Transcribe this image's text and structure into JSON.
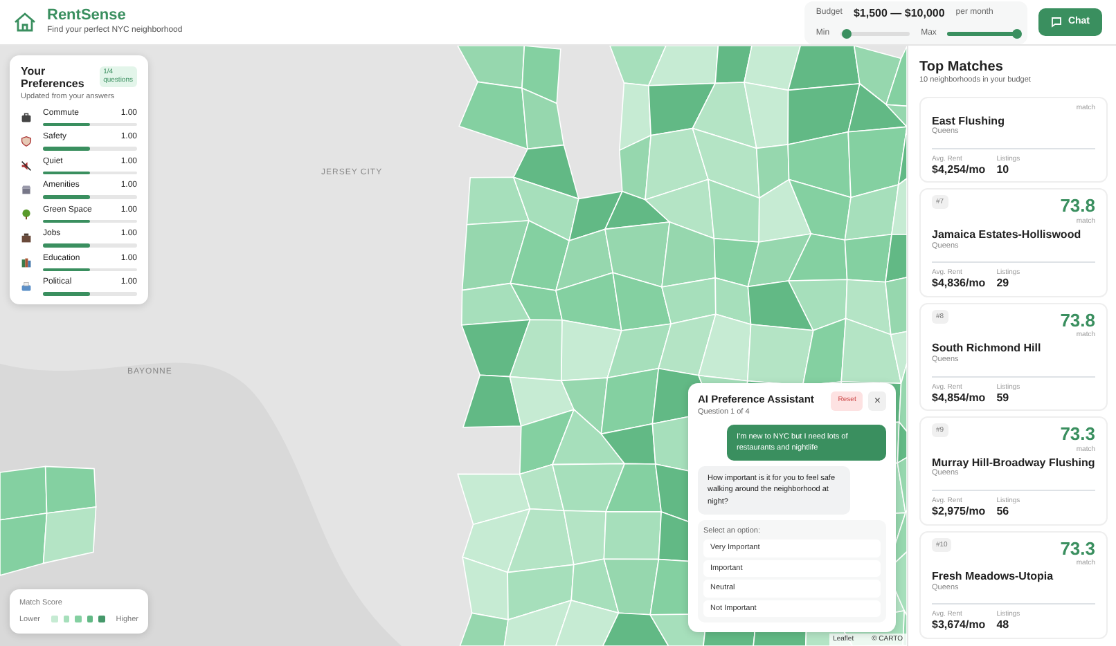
{
  "header": {
    "app_name": "RentSense",
    "tagline": "Find your perfect NYC neighborhood"
  },
  "budget": {
    "label": "Budget",
    "range": "$1,500 — $10,000",
    "unit": "per month",
    "sliders": [
      {
        "label": "Min",
        "level": 0.08
      },
      {
        "label": "Max",
        "level": 1
      }
    ]
  },
  "chat_button": "Chat",
  "map": {
    "labels": [
      "JERSEY CITY",
      "BAYONNE"
    ],
    "attribution": [
      "Leaflet",
      "© CARTO"
    ]
  },
  "preferences": {
    "title": "Your Preferences",
    "badge": "1/4 questions",
    "subtitle": "Updated from your answers",
    "items": [
      {
        "name": "Commute",
        "value": "1.00",
        "level": 0.5
      },
      {
        "name": "Safety",
        "value": "1.00",
        "level": 0.5
      },
      {
        "name": "Quiet",
        "value": "1.00",
        "level": 0.5
      },
      {
        "name": "Amenities",
        "value": "1.00",
        "level": 0.5
      },
      {
        "name": "Green Space",
        "value": "1.00",
        "level": 0.5
      },
      {
        "name": "Jobs",
        "value": "1.00",
        "level": 0.5
      },
      {
        "name": "Education",
        "value": "1.00",
        "level": 0.5
      },
      {
        "name": "Political",
        "value": "1.00",
        "level": 0.5
      }
    ]
  },
  "legend": {
    "title": "Match Score",
    "low": "Lower",
    "high": "Higher",
    "swatches": [
      {
        "color": "#c6ebd3"
      },
      {
        "color": "#a6dfbb"
      },
      {
        "color": "#84d0a1"
      },
      {
        "color": "#62b985"
      },
      {
        "color": "#45986a"
      }
    ]
  },
  "top_matches": {
    "title": "Top Matches",
    "subtitle": "10 neighborhoods in your budget",
    "cards": [
      {
        "score_label": "match",
        "name": "East Flushing",
        "borough": "Queens",
        "rent_label": "Avg. Rent",
        "rent": "$4,254/mo",
        "listings_label": "Listings",
        "listings": "10"
      },
      {
        "rank": "#7",
        "score": "73.8",
        "score_label": "match",
        "name": "Jamaica Estates-Holliswood",
        "borough": "Queens",
        "rent_label": "Avg. Rent",
        "rent": "$4,836/mo",
        "listings_label": "Listings",
        "listings": "29"
      },
      {
        "rank": "#8",
        "score": "73.8",
        "score_label": "match",
        "name": "South Richmond Hill",
        "borough": "Queens",
        "rent_label": "Avg. Rent",
        "rent": "$4,854/mo",
        "listings_label": "Listings",
        "listings": "59"
      },
      {
        "rank": "#9",
        "score": "73.3",
        "score_label": "match",
        "name": "Murray Hill-Broadway Flushing",
        "borough": "Queens",
        "rent_label": "Avg. Rent",
        "rent": "$2,975/mo",
        "listings_label": "Listings",
        "listings": "56"
      },
      {
        "rank": "#10",
        "score": "73.3",
        "score_label": "match",
        "name": "Fresh Meadows-Utopia",
        "borough": "Queens",
        "rent_label": "Avg. Rent",
        "rent": "$3,674/mo",
        "listings_label": "Listings",
        "listings": "48"
      }
    ]
  },
  "assistant": {
    "title": "AI Preference Assistant",
    "progress": "Question 1 of 4",
    "reset": "Reset",
    "close": "×",
    "messages": [
      {
        "kind": "user",
        "text": "I'm new to NYC but I need lots of restaurants and nightlife"
      },
      {
        "kind": "bot",
        "text": "How important is it for you to feel safe walking around the neighborhood at night?"
      }
    ],
    "prompt": "Select an option:",
    "options": [
      "Very Important",
      "Important",
      "Neutral",
      "Not Important"
    ]
  }
}
